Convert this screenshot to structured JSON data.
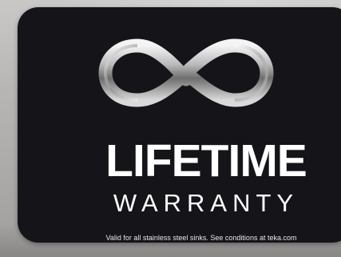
{
  "badge": {
    "title": "LIFETIME",
    "subtitle": "WARRANTY",
    "disclaimer": "Valid for all stainless steel sinks. See  conditions at teka.com",
    "logo_icon": "infinity-icon"
  },
  "colors": {
    "card_background": "#151419",
    "text": "#ffffff",
    "page_background": "#b7b6b4"
  }
}
